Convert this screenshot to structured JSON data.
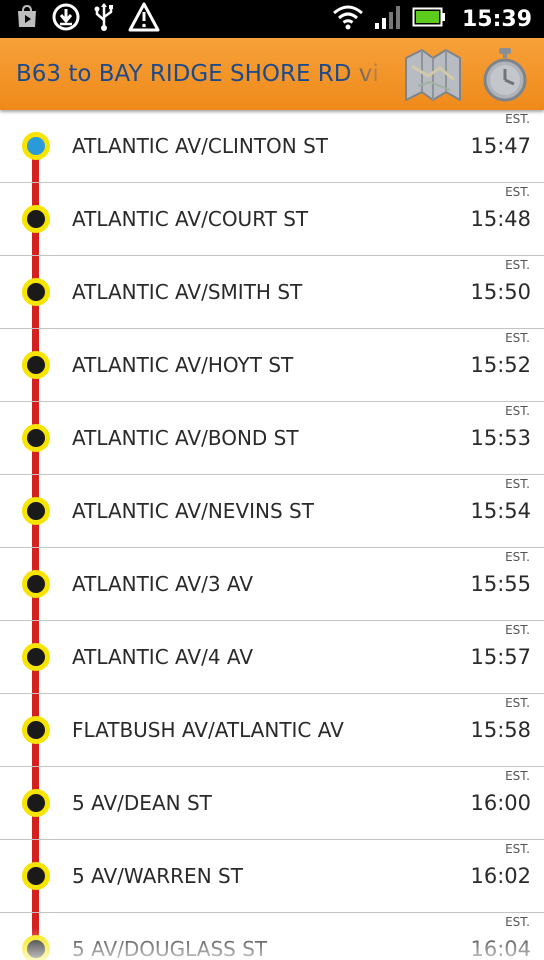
{
  "status_bar": {
    "time": "15:39",
    "icons": [
      "notification-play-store-icon",
      "download-icon",
      "usb-icon",
      "warning-icon",
      "wifi-icon",
      "signal-icon",
      "battery-icon"
    ]
  },
  "header": {
    "route_title": "B63 to BAY RIDGE SHORE RD vi",
    "icons": [
      "map-icon",
      "stopwatch-icon"
    ],
    "accent_color": "#ef8a1a",
    "title_color": "#1f4a8a"
  },
  "stops": {
    "est_label": "EST.",
    "line_color": "#d4201f",
    "dot_ring_color": "#f7e500",
    "current_dot_color": "#2a9ad8",
    "items": [
      {
        "name": "ATLANTIC AV/CLINTON ST",
        "time": "15:47",
        "current": true
      },
      {
        "name": "ATLANTIC AV/COURT ST",
        "time": "15:48",
        "current": false
      },
      {
        "name": "ATLANTIC AV/SMITH ST",
        "time": "15:50",
        "current": false
      },
      {
        "name": "ATLANTIC AV/HOYT ST",
        "time": "15:52",
        "current": false
      },
      {
        "name": "ATLANTIC AV/BOND ST",
        "time": "15:53",
        "current": false
      },
      {
        "name": "ATLANTIC AV/NEVINS ST",
        "time": "15:54",
        "current": false
      },
      {
        "name": "ATLANTIC AV/3 AV",
        "time": "15:55",
        "current": false
      },
      {
        "name": "ATLANTIC AV/4 AV",
        "time": "15:57",
        "current": false
      },
      {
        "name": "FLATBUSH AV/ATLANTIC AV",
        "time": "15:58",
        "current": false
      },
      {
        "name": "5 AV/DEAN ST",
        "time": "16:00",
        "current": false
      },
      {
        "name": "5 AV/WARREN ST",
        "time": "16:02",
        "current": false
      },
      {
        "name": "5 AV/DOUGLASS ST",
        "time": "16:04",
        "current": false
      }
    ]
  }
}
